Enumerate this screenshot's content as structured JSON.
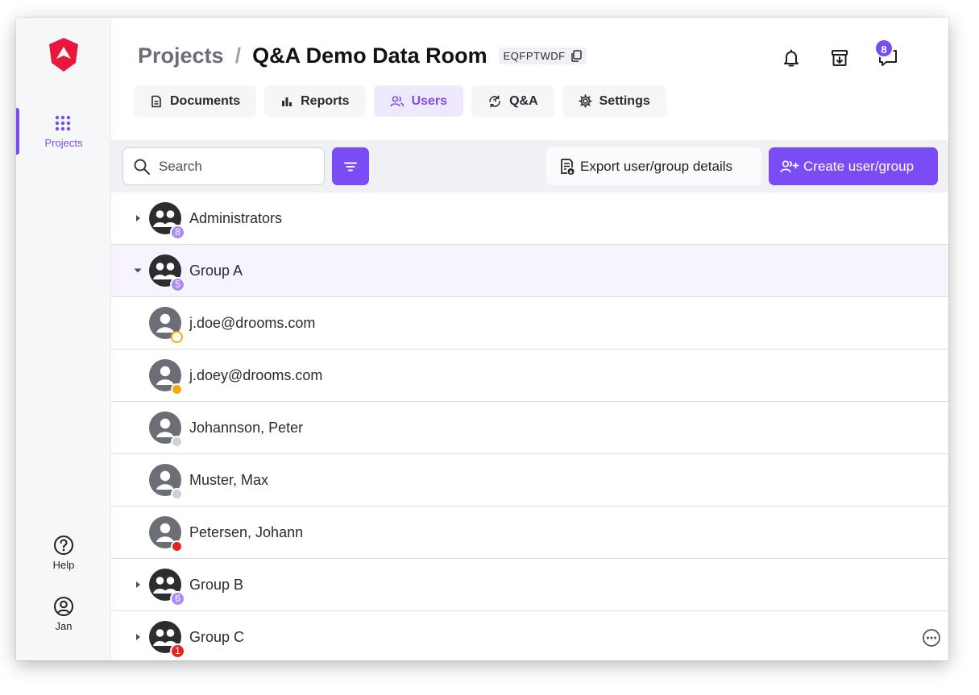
{
  "sidebar": {
    "nav": [
      {
        "label": "Projects",
        "icon": "grid-dots-icon",
        "active": true
      }
    ],
    "bottom": [
      {
        "label": "Help",
        "icon": "help-circle-icon"
      },
      {
        "label": "Jan",
        "icon": "user-circle-icon"
      }
    ]
  },
  "header": {
    "breadcrumb_parent": "Projects",
    "breadcrumb_separator": "/",
    "breadcrumb_current": "Q&A Demo Data Room",
    "room_code": "EQFPTWDF",
    "messages_badge": "8"
  },
  "tabs": [
    {
      "label": "Documents",
      "icon": "document-icon",
      "active": false
    },
    {
      "label": "Reports",
      "icon": "bar-chart-icon",
      "active": false
    },
    {
      "label": "Users",
      "icon": "users-icon",
      "active": true
    },
    {
      "label": "Q&A",
      "icon": "refresh-chat-icon",
      "active": false
    },
    {
      "label": "Settings",
      "icon": "gear-icon",
      "active": false
    }
  ],
  "toolbar": {
    "search_placeholder": "Search",
    "export_label": "Export user/group details",
    "create_label": "Create user/group"
  },
  "rows": [
    {
      "type": "group",
      "label": "Administrators",
      "count": "8",
      "count_color": "#a98af7",
      "expanded": false
    },
    {
      "type": "group",
      "label": "Group A",
      "count": "5",
      "count_color": "#a98af7",
      "expanded": true
    },
    {
      "type": "user",
      "label": "j.doe@drooms.com",
      "status": "pending-outline"
    },
    {
      "type": "user",
      "label": "j.doey@drooms.com",
      "status": "#f3a814"
    },
    {
      "type": "user",
      "label": "Johannson, Peter",
      "status": "#cfd1d6"
    },
    {
      "type": "user",
      "label": "Muster, Max",
      "status": "#cfd1d6"
    },
    {
      "type": "user",
      "label": "Petersen, Johann",
      "status": "#e0271f"
    },
    {
      "type": "group",
      "label": "Group B",
      "count": "6",
      "count_color": "#a98af7",
      "expanded": false
    },
    {
      "type": "group",
      "label": "Group C",
      "count": "1",
      "count_color": "#e0271f",
      "expanded": false,
      "has_more": true
    }
  ],
  "colors": {
    "accent": "#7b4bf5",
    "brand_red": "#e8173c"
  }
}
